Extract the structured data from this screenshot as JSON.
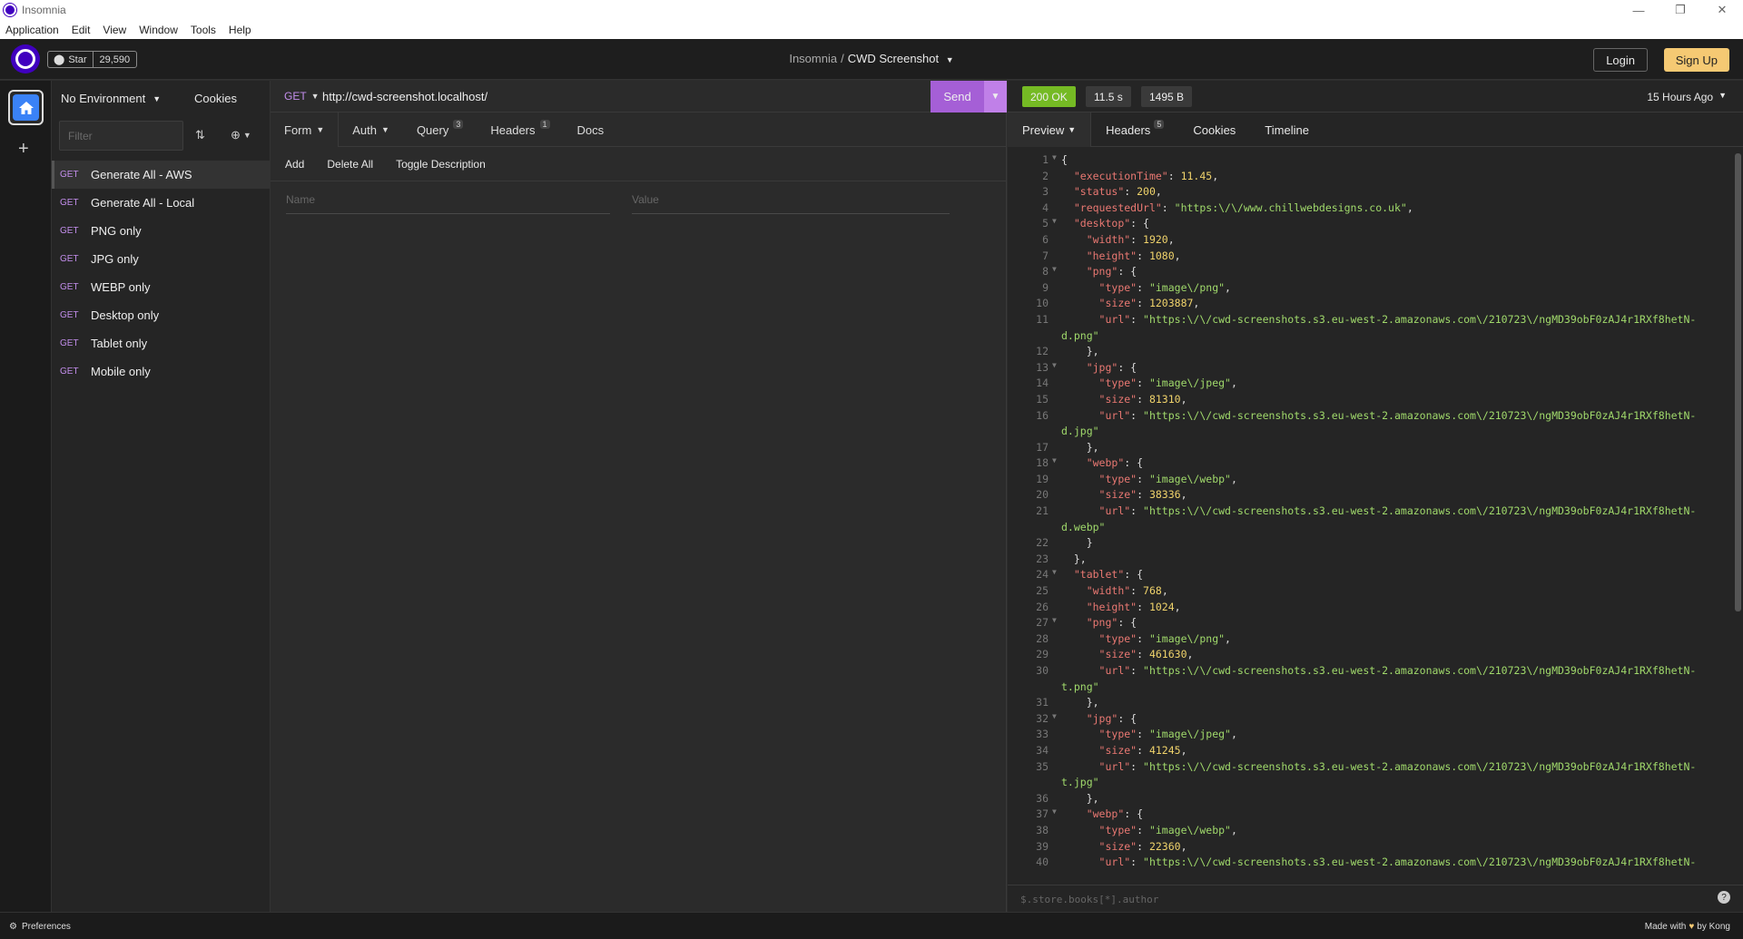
{
  "window": {
    "title": "Insomnia",
    "controls": [
      "—",
      "❐",
      "✕"
    ]
  },
  "menu": [
    "Application",
    "Edit",
    "View",
    "Window",
    "Tools",
    "Help"
  ],
  "header": {
    "star_label": "Star",
    "star_count": "29,590",
    "breadcrumb_root": "Insomnia",
    "breadcrumb_sep": "/",
    "breadcrumb_current": "CWD Screenshot",
    "login": "Login",
    "signup": "Sign Up"
  },
  "sidebar": {
    "environment": "No Environment",
    "cookies": "Cookies",
    "filter_placeholder": "Filter",
    "requests": [
      {
        "method": "GET",
        "name": "Generate All - AWS"
      },
      {
        "method": "GET",
        "name": "Generate All - Local"
      },
      {
        "method": "GET",
        "name": "PNG only"
      },
      {
        "method": "GET",
        "name": "JPG only"
      },
      {
        "method": "GET",
        "name": "WEBP only"
      },
      {
        "method": "GET",
        "name": "Desktop only"
      },
      {
        "method": "GET",
        "name": "Tablet only"
      },
      {
        "method": "GET",
        "name": "Mobile only"
      }
    ]
  },
  "request": {
    "method": "GET",
    "url": "http://cwd-screenshot.localhost/",
    "send": "Send",
    "tabs": [
      {
        "label": "Form",
        "badge": ""
      },
      {
        "label": "Auth",
        "badge": ""
      },
      {
        "label": "Query",
        "badge": "3"
      },
      {
        "label": "Headers",
        "badge": "1"
      },
      {
        "label": "Docs",
        "badge": ""
      }
    ],
    "actions": [
      "Add",
      "Delete All",
      "Toggle Description"
    ],
    "name_placeholder": "Name",
    "value_placeholder": "Value"
  },
  "response": {
    "status": "200 OK",
    "time": "11.5 s",
    "size": "1495 B",
    "ago": "15 Hours Ago",
    "tabs": [
      {
        "label": "Preview",
        "badge": ""
      },
      {
        "label": "Headers",
        "badge": "5"
      },
      {
        "label": "Cookies",
        "badge": ""
      },
      {
        "label": "Timeline",
        "badge": ""
      }
    ],
    "filter_placeholder": "$.store.books[*].author",
    "help": "?",
    "lines": [
      {
        "n": "1",
        "f": true,
        "t": "{"
      },
      {
        "n": "2",
        "f": false,
        "t": "  \"executionTime\": 11.45,"
      },
      {
        "n": "3",
        "f": false,
        "t": "  \"status\": 200,"
      },
      {
        "n": "4",
        "f": false,
        "t": "  \"requestedUrl\": \"https:\\/\\/www.chillwebdesigns.co.uk\","
      },
      {
        "n": "5",
        "f": true,
        "t": "  \"desktop\": {"
      },
      {
        "n": "6",
        "f": false,
        "t": "    \"width\": 1920,"
      },
      {
        "n": "7",
        "f": false,
        "t": "    \"height\": 1080,"
      },
      {
        "n": "8",
        "f": true,
        "t": "    \"png\": {"
      },
      {
        "n": "9",
        "f": false,
        "t": "      \"type\": \"image\\/png\","
      },
      {
        "n": "10",
        "f": false,
        "t": "      \"size\": 1203887,"
      },
      {
        "n": "11",
        "f": false,
        "t": "      \"url\": \"https:\\/\\/cwd-screenshots.s3.eu-west-2.amazonaws.com\\/210723\\/ngMD39obF0zAJ4r1RXf8hetN-"
      },
      {
        "n": "",
        "f": false,
        "t": "d.png\""
      },
      {
        "n": "12",
        "f": false,
        "t": "    },"
      },
      {
        "n": "13",
        "f": true,
        "t": "    \"jpg\": {"
      },
      {
        "n": "14",
        "f": false,
        "t": "      \"type\": \"image\\/jpeg\","
      },
      {
        "n": "15",
        "f": false,
        "t": "      \"size\": 81310,"
      },
      {
        "n": "16",
        "f": false,
        "t": "      \"url\": \"https:\\/\\/cwd-screenshots.s3.eu-west-2.amazonaws.com\\/210723\\/ngMD39obF0zAJ4r1RXf8hetN-"
      },
      {
        "n": "",
        "f": false,
        "t": "d.jpg\""
      },
      {
        "n": "17",
        "f": false,
        "t": "    },"
      },
      {
        "n": "18",
        "f": true,
        "t": "    \"webp\": {"
      },
      {
        "n": "19",
        "f": false,
        "t": "      \"type\": \"image\\/webp\","
      },
      {
        "n": "20",
        "f": false,
        "t": "      \"size\": 38336,"
      },
      {
        "n": "21",
        "f": false,
        "t": "      \"url\": \"https:\\/\\/cwd-screenshots.s3.eu-west-2.amazonaws.com\\/210723\\/ngMD39obF0zAJ4r1RXf8hetN-"
      },
      {
        "n": "",
        "f": false,
        "t": "d.webp\""
      },
      {
        "n": "22",
        "f": false,
        "t": "    }"
      },
      {
        "n": "23",
        "f": false,
        "t": "  },"
      },
      {
        "n": "24",
        "f": true,
        "t": "  \"tablet\": {"
      },
      {
        "n": "25",
        "f": false,
        "t": "    \"width\": 768,"
      },
      {
        "n": "26",
        "f": false,
        "t": "    \"height\": 1024,"
      },
      {
        "n": "27",
        "f": true,
        "t": "    \"png\": {"
      },
      {
        "n": "28",
        "f": false,
        "t": "      \"type\": \"image\\/png\","
      },
      {
        "n": "29",
        "f": false,
        "t": "      \"size\": 461630,"
      },
      {
        "n": "30",
        "f": false,
        "t": "      \"url\": \"https:\\/\\/cwd-screenshots.s3.eu-west-2.amazonaws.com\\/210723\\/ngMD39obF0zAJ4r1RXf8hetN-"
      },
      {
        "n": "",
        "f": false,
        "t": "t.png\""
      },
      {
        "n": "31",
        "f": false,
        "t": "    },"
      },
      {
        "n": "32",
        "f": true,
        "t": "    \"jpg\": {"
      },
      {
        "n": "33",
        "f": false,
        "t": "      \"type\": \"image\\/jpeg\","
      },
      {
        "n": "34",
        "f": false,
        "t": "      \"size\": 41245,"
      },
      {
        "n": "35",
        "f": false,
        "t": "      \"url\": \"https:\\/\\/cwd-screenshots.s3.eu-west-2.amazonaws.com\\/210723\\/ngMD39obF0zAJ4r1RXf8hetN-"
      },
      {
        "n": "",
        "f": false,
        "t": "t.jpg\""
      },
      {
        "n": "36",
        "f": false,
        "t": "    },"
      },
      {
        "n": "37",
        "f": true,
        "t": "    \"webp\": {"
      },
      {
        "n": "38",
        "f": false,
        "t": "      \"type\": \"image\\/webp\","
      },
      {
        "n": "39",
        "f": false,
        "t": "      \"size\": 22360,"
      },
      {
        "n": "40",
        "f": false,
        "t": "      \"url\": \"https:\\/\\/cwd-screenshots.s3.eu-west-2.amazonaws.com\\/210723\\/ngMD39obF0zAJ4r1RXf8hetN-"
      }
    ]
  },
  "footer": {
    "preferences": "Preferences",
    "made_with": "Made with",
    "by": "by Kong"
  },
  "colors": {
    "accent": "#4000bf",
    "send": "#a55fd6",
    "ok": "#75ba24",
    "signup": "#f5c973",
    "method": "#c38eec"
  }
}
